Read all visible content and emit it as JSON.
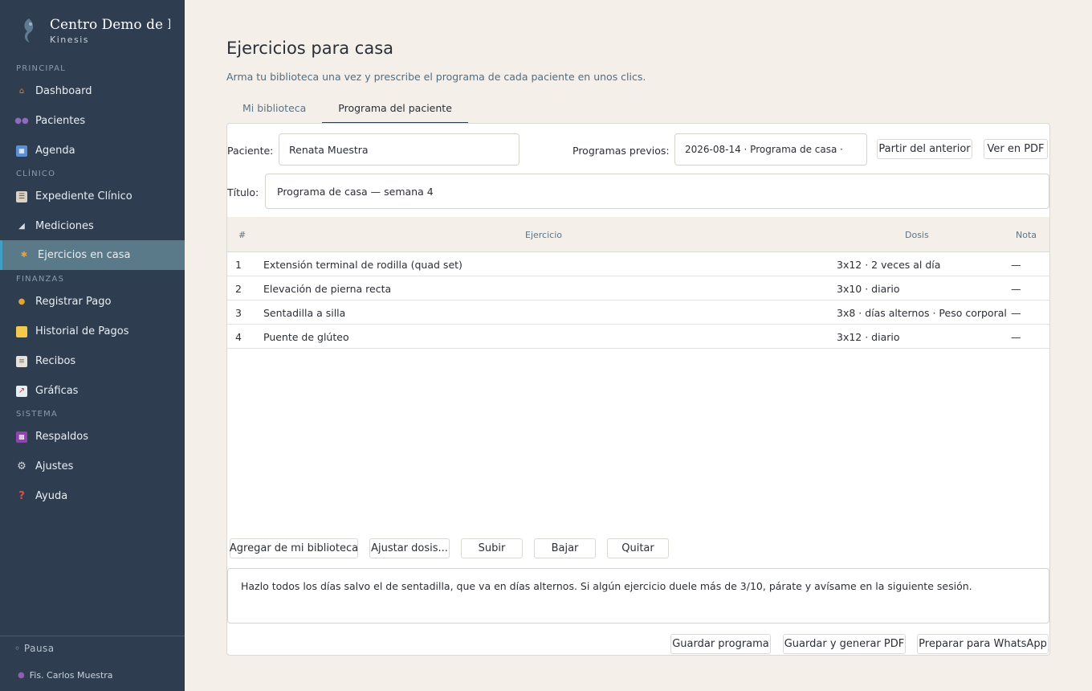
{
  "app": {
    "brand_name": "Centro Demo de Rehabilitación",
    "brand_sub": "Kinesis"
  },
  "sidebar": {
    "sections": [
      {
        "label": "PRINCIPAL"
      },
      {
        "label": "CLÍNICO"
      },
      {
        "label": "FINANZAS"
      },
      {
        "label": "SISTEMA"
      }
    ],
    "items": [
      {
        "label": "Dashboard",
        "icon": "house-icon"
      },
      {
        "label": "Pacientes",
        "icon": "people-icon"
      },
      {
        "label": "Agenda",
        "icon": "calendar-icon"
      },
      {
        "label": "Expediente Clínico",
        "icon": "clipboard-icon"
      },
      {
        "label": "Mediciones",
        "icon": "ruler-icon"
      },
      {
        "label": "Ejercicios en casa",
        "icon": "runner-icon"
      },
      {
        "label": "Registrar Pago",
        "icon": "money-bag-icon"
      },
      {
        "label": "Historial de Pagos",
        "icon": "ledger-icon"
      },
      {
        "label": "Recibos",
        "icon": "receipt-icon"
      },
      {
        "label": "Gráficas",
        "icon": "chart-icon"
      },
      {
        "label": "Respaldos",
        "icon": "floppy-icon"
      },
      {
        "label": "Ajustes",
        "icon": "gear-icon"
      },
      {
        "label": "Ayuda",
        "icon": "question-icon"
      }
    ],
    "active_index": 5,
    "status": "◦ Pausa",
    "user": "Fis. Carlos Muestra"
  },
  "main": {
    "title": "Ejercicios para casa",
    "subtitle": "Arma tu biblioteca una vez y prescribe el programa de cada paciente en unos clics.",
    "tabs": [
      {
        "label": "Mi biblioteca"
      },
      {
        "label": "Programa del paciente"
      }
    ],
    "active_tab": 1
  },
  "form": {
    "patient_label": "Paciente:",
    "patient_value": "Renata Muestra",
    "previous_label": "Programas previos:",
    "previous_value": "2026-08-14 · Programa de casa ·",
    "from_previous_button": "Partir del anterior",
    "view_pdf_button": "Ver en PDF",
    "title_label": "Título:",
    "title_value": "Programa de casa — semana 4"
  },
  "table": {
    "headers": {
      "num": "#",
      "exercise": "Ejercicio",
      "dose": "Dosis",
      "note": "Nota"
    },
    "rows": [
      {
        "num": "1",
        "exercise": "Extensión terminal de rodilla (quad set)",
        "dose": "3x12 · 2 veces al día",
        "note": "—"
      },
      {
        "num": "2",
        "exercise": "Elevación de pierna recta",
        "dose": "3x10 · diario",
        "note": "—"
      },
      {
        "num": "3",
        "exercise": "Sentadilla a silla",
        "dose": "3x8 · días alternos · Peso corporal",
        "note": "—"
      },
      {
        "num": "4",
        "exercise": "Puente de glúteo",
        "dose": "3x12 · diario",
        "note": "—"
      }
    ]
  },
  "actions": {
    "add_from_library": "Agregar de mi biblioteca",
    "adjust_dose": "Ajustar dosis...",
    "move_up": "Subir",
    "move_down": "Bajar",
    "remove": "Quitar"
  },
  "notes": "Hazlo todos los días salvo el de sentadilla, que va en días alternos. Si algún ejercicio duele más de 3/10, párate y avísame en la siguiente sesión.",
  "footer": {
    "save": "Guardar programa",
    "save_pdf": "Guardar y generar PDF",
    "whatsapp": "Preparar para WhatsApp"
  }
}
